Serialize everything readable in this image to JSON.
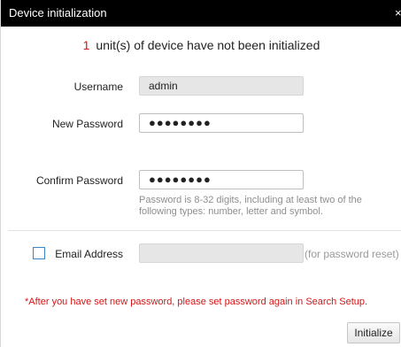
{
  "window": {
    "title": "Device initialization",
    "close_glyph": "×"
  },
  "notice": {
    "count": "1",
    "text": "unit(s) of device have not been initialized"
  },
  "form": {
    "username": {
      "label": "Username",
      "value": "admin"
    },
    "new_password": {
      "label": "New Password",
      "masked_value": "●●●●●●●●"
    },
    "confirm_password": {
      "label": "Confirm Password",
      "masked_value": "●●●●●●●●",
      "hint": "Password is 8-32 digits, including at least two of the following types: number, letter and symbol."
    },
    "email": {
      "label": "Email Address",
      "value": "",
      "hint": "(for password reset)",
      "checked": false
    }
  },
  "warning": "*After you have set new password, please set password again in Search Setup.",
  "actions": {
    "initialize_label": "Initialize"
  },
  "colors": {
    "titlebar_bg": "#000000",
    "accent_red": "#d41616",
    "checkbox_border": "#3a86c8",
    "hint_gray": "#8e8e8e"
  }
}
